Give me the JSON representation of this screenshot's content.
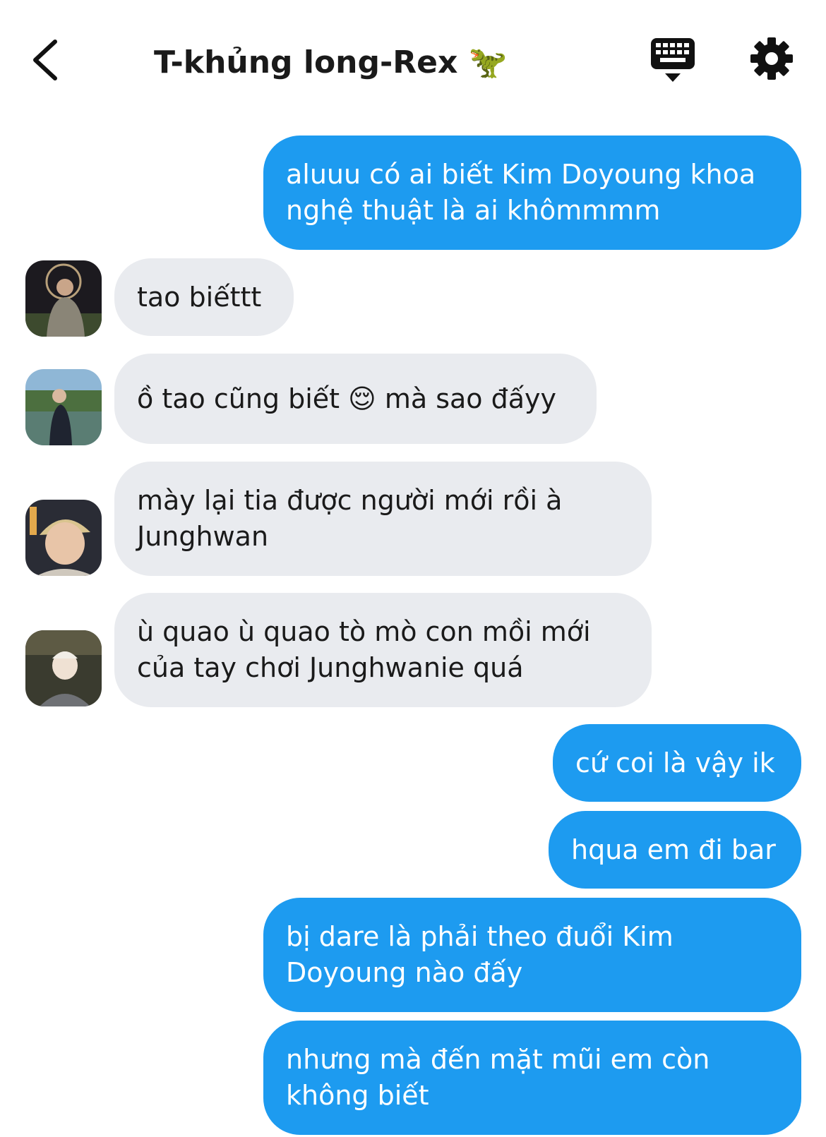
{
  "header": {
    "title": "T-khủng long-Rex 🦖",
    "back_icon": "chevron-left-icon",
    "keyboard_icon": "keyboard-icon",
    "settings_icon": "gear-icon"
  },
  "messages": [
    {
      "direction": "sent",
      "text": "aluuu có ai biết Kim Doyoung khoa nghệ thuật là ai khômmmm"
    },
    {
      "direction": "received",
      "text": "tao biếttt"
    },
    {
      "direction": "received",
      "text": "ồ tao cũng biết 😌  mà sao đấyy"
    },
    {
      "direction": "received",
      "text": "mày lại tia được người mới rồi à Junghwan"
    },
    {
      "direction": "received",
      "text": "ù quao ù quao tò mò con mồi mới của tay chơi Junghwanie quá"
    },
    {
      "direction": "sent",
      "text": "cứ coi là vậy ik"
    },
    {
      "direction": "sent",
      "text": "hqua em đi bar"
    },
    {
      "direction": "sent",
      "text": "bị dare là phải theo đuổi Kim Doyoung nào đấy"
    },
    {
      "direction": "sent",
      "text": "nhưng mà đến mặt mũi em còn không biết"
    }
  ],
  "colors": {
    "sent_bubble": "#1d9bf0",
    "received_bubble": "#e9ebef",
    "text_dark": "#1a1a1a"
  }
}
